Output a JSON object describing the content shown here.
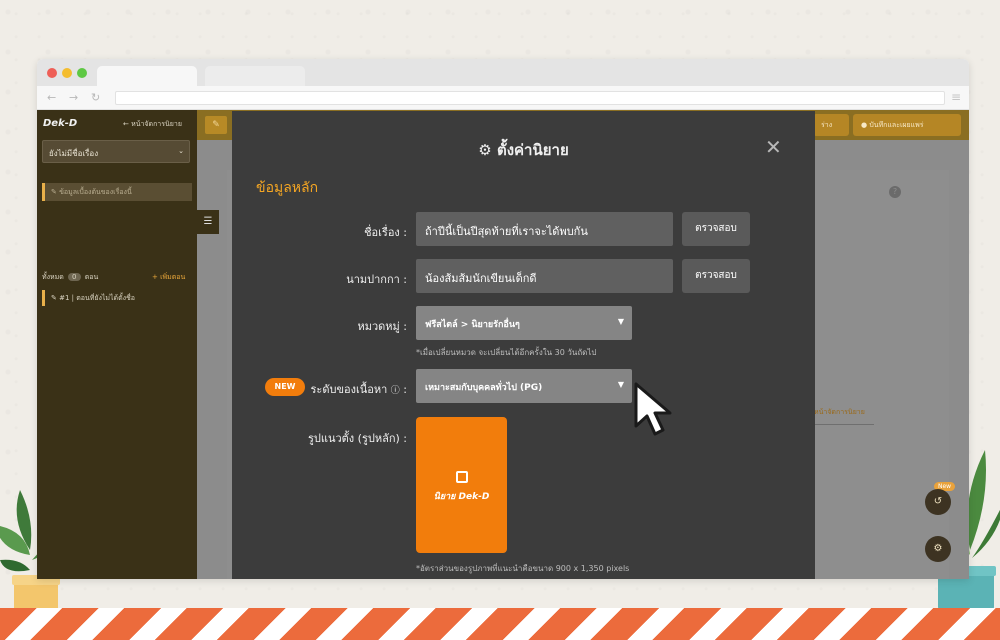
{
  "browser": {
    "nav": {
      "back": "←",
      "forward": "→",
      "reload": "↻",
      "menu": "≡"
    }
  },
  "sidebar": {
    "logo": "Dek-D",
    "back_link": "← หน้าจัดการนิยาย",
    "story_select": "ยังไม่มีชื่อเรื่อง",
    "main_info_item": "ข้อมูลเบื้องต้นของเรื่องนี้",
    "count_prefix": "ทั้งหมด",
    "count_value": "0",
    "count_suffix": "ตอน",
    "add_episode": "+ เพิ่มตอน",
    "episode_item": "#1 | ตอนที่ยังไม่ได้ตั้งชื่อ"
  },
  "topbar": {
    "btn1_label": "ร่าง",
    "btn2_label": "บันทึกและเผยแพร่"
  },
  "page": {
    "right_link": "หน้าจัดการนิยาย",
    "help": "?",
    "new_badge": "New"
  },
  "modal": {
    "title": "ตั้งค่านิยาย",
    "section_title": "ข้อมูลหลัก",
    "title_label": "ชื่อเรื่อง :",
    "title_value": "ถ้าปีนี้เป็นปีสุดท้ายที่เราจะได้พบกัน",
    "check_button": "ตรวจสอบ",
    "penname_label": "นามปากกา :",
    "penname_value": "น้องส้มส้มนักเขียนเด็กดี",
    "category_label": "หมวดหมู่ :",
    "category_value": "ฟรีสไตล์ > นิยายรักอื่นๆ",
    "category_hint": "*เมื่อเปลี่ยนหมวด จะเปลี่ยนได้อีกครั้งใน 30 วันถัดไป",
    "new_pill": "NEW",
    "rating_label": "ระดับของเนื้อหา",
    "rating_value": "เหมาะสมกับบุคคลทั่วไป (PG)",
    "cover_label": "รูปแนวตั้ง (รูปหลัก) :",
    "cover_logo_text": "นิยาย Dek-D",
    "cover_hint": "*อัตราส่วนของรูปภาพที่แนะนำคือขนาด 900 x 1,350 pixels"
  },
  "colors": {
    "accent": "#f27d0c",
    "section_title": "#f5a623",
    "modal_bg": "#3c3c3c",
    "sidebar_bg": "#3a3117"
  }
}
